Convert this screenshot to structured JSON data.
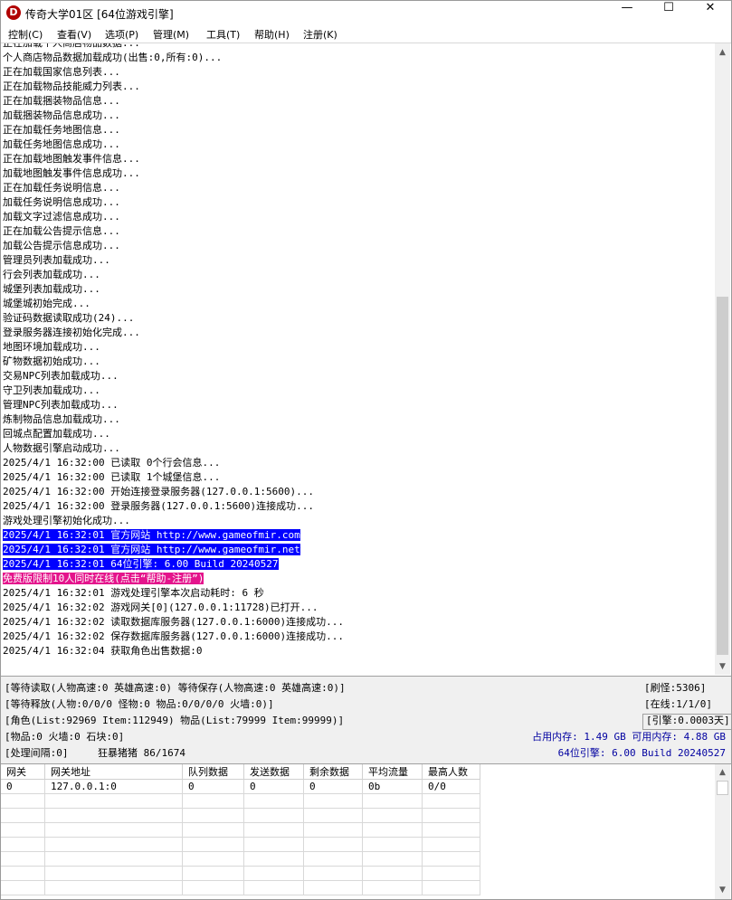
{
  "window": {
    "icon_letter": "D",
    "title": "传奇大学01区 [64位游戏引擎]",
    "minimize": "—",
    "maximize": "☐",
    "close": "✕"
  },
  "menu": [
    "控制(C)",
    "查看(V)",
    "选项(P)",
    "管理(M)",
    "工具(T)",
    "帮助(H)",
    "注册(K)"
  ],
  "log": [
    {
      "text": "正在加载个人商店物品数据...",
      "style": "cut"
    },
    {
      "text": "个人商店物品数据加载成功(出售:0,所有:0)...",
      "style": ""
    },
    {
      "text": "正在加载国家信息列表...",
      "style": ""
    },
    {
      "text": "正在加载物品技能威力列表...",
      "style": ""
    },
    {
      "text": "正在加载捆装物品信息...",
      "style": ""
    },
    {
      "text": "加载捆装物品信息成功...",
      "style": ""
    },
    {
      "text": "正在加载任务地图信息...",
      "style": ""
    },
    {
      "text": "加载任务地图信息成功...",
      "style": ""
    },
    {
      "text": "正在加载地图触发事件信息...",
      "style": ""
    },
    {
      "text": "加载地图触发事件信息成功...",
      "style": ""
    },
    {
      "text": "正在加载任务说明信息...",
      "style": ""
    },
    {
      "text": "加载任务说明信息成功...",
      "style": ""
    },
    {
      "text": "加载文字过滤信息成功...",
      "style": ""
    },
    {
      "text": "正在加载公告提示信息...",
      "style": ""
    },
    {
      "text": "加载公告提示信息成功...",
      "style": ""
    },
    {
      "text": "管理员列表加载成功...",
      "style": ""
    },
    {
      "text": "行会列表加载成功...",
      "style": ""
    },
    {
      "text": "城堡列表加载成功...",
      "style": ""
    },
    {
      "text": "城堡城初始完成...",
      "style": ""
    },
    {
      "text": "验证码数据读取成功(24)...",
      "style": ""
    },
    {
      "text": "登录服务器连接初始化完成...",
      "style": ""
    },
    {
      "text": "地图环境加载成功...",
      "style": ""
    },
    {
      "text": "矿物数据初始成功...",
      "style": ""
    },
    {
      "text": "交易NPC列表加载成功...",
      "style": ""
    },
    {
      "text": "守卫列表加载成功...",
      "style": ""
    },
    {
      "text": "管理NPC列表加载成功...",
      "style": ""
    },
    {
      "text": "炼制物品信息加载成功...",
      "style": ""
    },
    {
      "text": "回城点配置加载成功...",
      "style": ""
    },
    {
      "text": "人物数据引擎启动成功...",
      "style": ""
    },
    {
      "text": "2025/4/1 16:32:00 已读取 0个行会信息...",
      "style": ""
    },
    {
      "text": "2025/4/1 16:32:00 已读取 1个城堡信息...",
      "style": ""
    },
    {
      "text": "2025/4/1 16:32:00 开始连接登录服务器(127.0.0.1:5600)...",
      "style": ""
    },
    {
      "text": "2025/4/1 16:32:00 登录服务器(127.0.0.1:5600)连接成功...",
      "style": ""
    },
    {
      "text": "游戏处理引擎初始化成功...",
      "style": ""
    },
    {
      "text": "2025/4/1 16:32:01 官方网站 http://www.gameofmir.com",
      "style": "blue"
    },
    {
      "text": "2025/4/1 16:32:01 官方网站 http://www.gameofmir.net",
      "style": "blue"
    },
    {
      "text": "2025/4/1 16:32:01 64位引擎: 6.00 Build 20240527",
      "style": "blue"
    },
    {
      "text": "免费版限制10人同时在线(点击“帮助-注册”)",
      "style": "pink"
    },
    {
      "text": "2025/4/1 16:32:01 游戏处理引擎本次启动耗时: 6 秒",
      "style": ""
    },
    {
      "text": "2025/4/1 16:32:02 游戏网关[0](127.0.0.1:11728)已打开...",
      "style": ""
    },
    {
      "text": "2025/4/1 16:32:02 读取数据库服务器(127.0.0.1:6000)连接成功...",
      "style": ""
    },
    {
      "text": "2025/4/1 16:32:02 保存数据库服务器(127.0.0.1:6000)连接成功...",
      "style": ""
    },
    {
      "text": "2025/4/1 16:32:04 获取角色出售数据:0",
      "style": ""
    }
  ],
  "status": {
    "wait_read": "[等待读取(人物高速:0 英雄高速:0) 等待保存(人物高速:0 英雄高速:0)]",
    "wait_release": "[等待释放(人物:0/0/0 怪物:0 物品:0/0/0/0 火墙:0)]",
    "role": "[角色(List:92969 Item:112949) 物品(List:79999 Item:99999)]",
    "items": "[物品:0 火墙:0 石块:0]",
    "process": "[处理间隔:0]",
    "mob": "狂暴猪猪 86/1674",
    "refresh": "[刷怪:5306]",
    "online": "[在线:1/1/0]",
    "engine_time": "[引擎:0.0003天]",
    "memory": "占用内存: 1.49 GB 可用内存: 4.88 GB",
    "build": "64位引擎: 6.00 Build 20240527"
  },
  "gateway_table": {
    "headers": [
      "网关",
      "网关地址",
      "队列数据",
      "发送数据",
      "剩余数据",
      "平均流量",
      "最高人数"
    ],
    "rows": [
      [
        "0",
        "127.0.0.1:0",
        "0",
        "0",
        "0",
        "0b",
        "0/0"
      ]
    ]
  }
}
